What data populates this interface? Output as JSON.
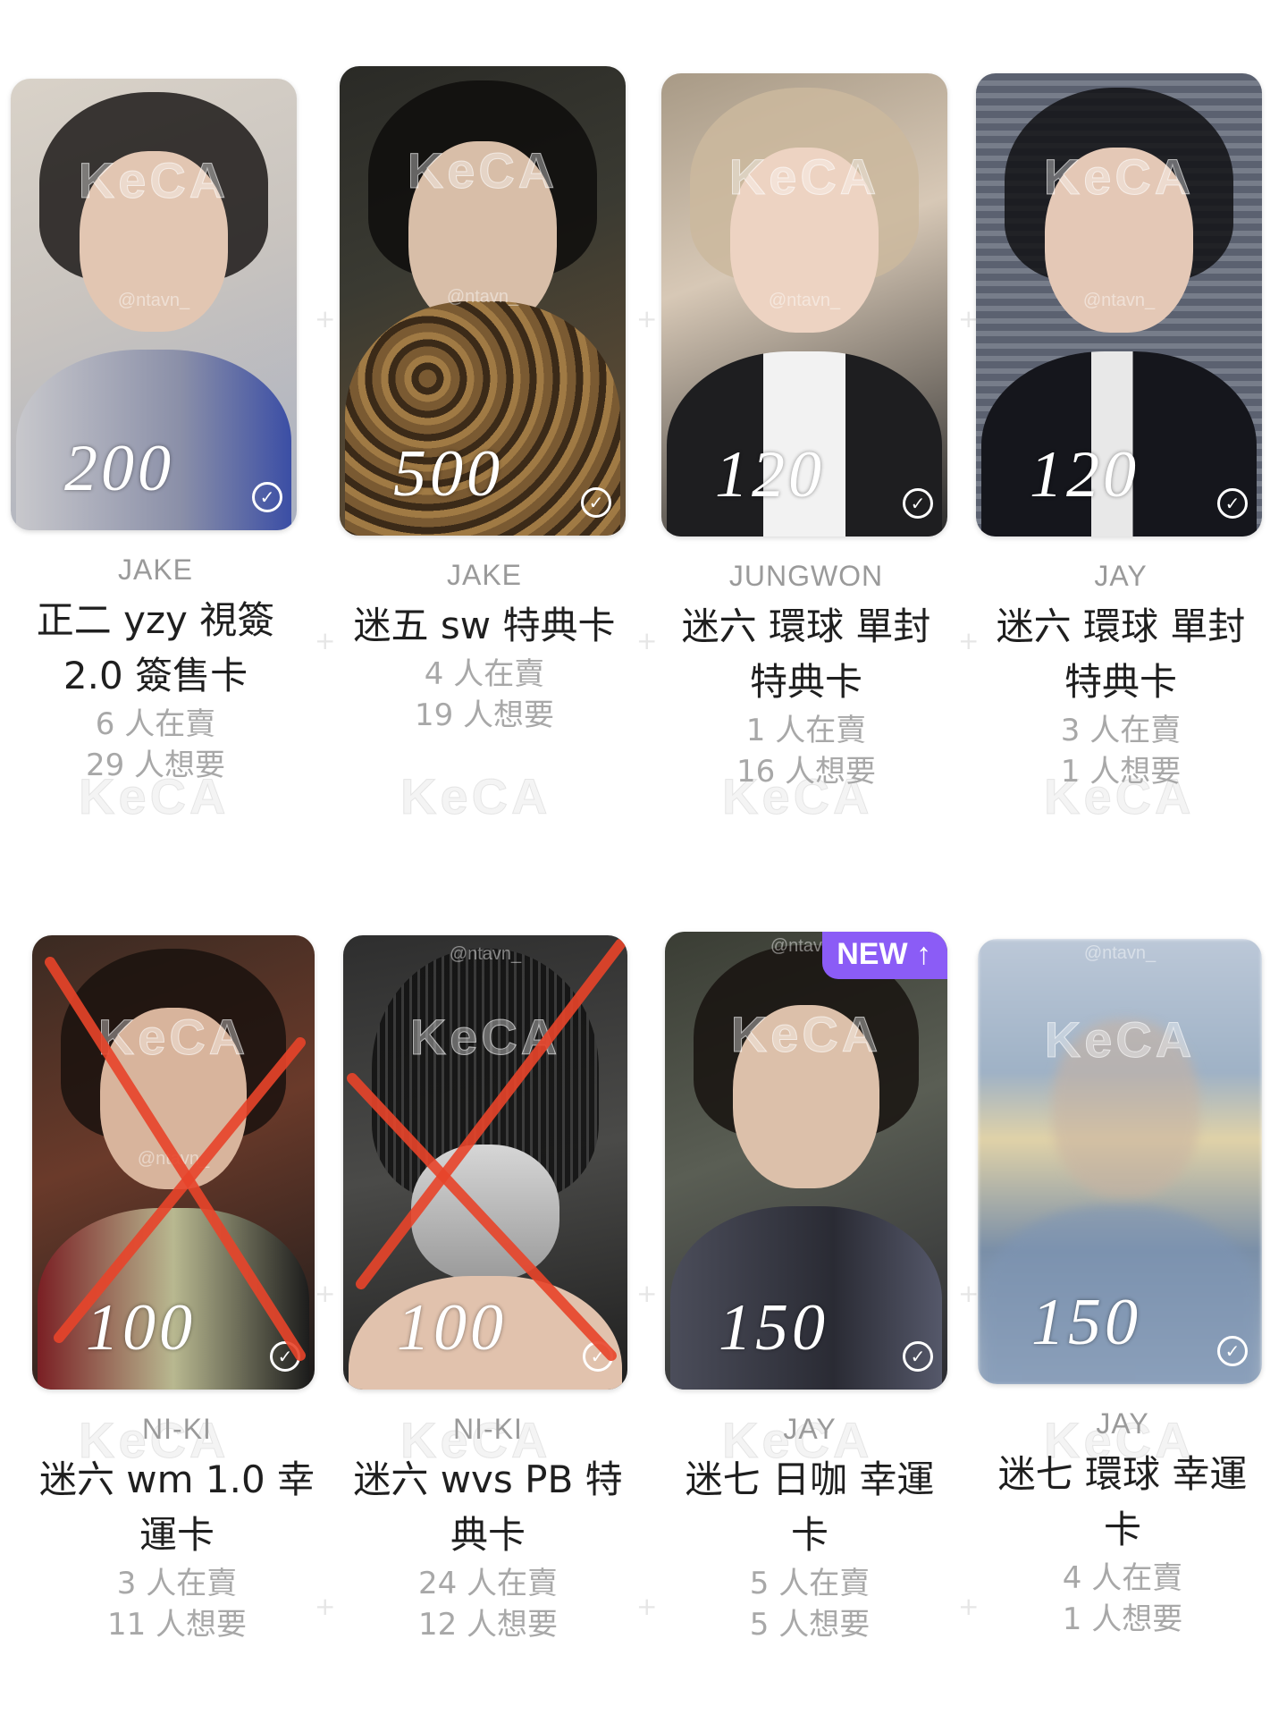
{
  "watermark": "KeCA",
  "handle": "@ntavn_",
  "stat_sell_suffix": "人在賣",
  "stat_want_suffix": "人想要",
  "badge_new": "NEW ↑",
  "colors": {
    "badge": "#8b5cf6",
    "cross": "#e8442a"
  },
  "cards": [
    {
      "member": "JAKE",
      "title_lines": [
        "正二 yzy 視簽",
        "2.0 簽售卡"
      ],
      "price": "200",
      "sellers": "6",
      "wanters": "29",
      "sold_out": false,
      "is_new": false
    },
    {
      "member": "JAKE",
      "title_lines": [
        "迷五 sw 特典卡"
      ],
      "price": "500",
      "sellers": "4",
      "wanters": "19",
      "sold_out": false,
      "is_new": false
    },
    {
      "member": "JUNGWON",
      "title_lines": [
        "迷六 環球 單封",
        "特典卡"
      ],
      "price": "120",
      "sellers": "1",
      "wanters": "16",
      "sold_out": false,
      "is_new": false
    },
    {
      "member": "JAY",
      "title_lines": [
        "迷六 環球 單封",
        "特典卡"
      ],
      "price": "120",
      "sellers": "3",
      "wanters": "1",
      "sold_out": false,
      "is_new": false
    },
    {
      "member": "NI-KI",
      "title_lines": [
        "迷六 wm 1.0 幸",
        "運卡"
      ],
      "price": "100",
      "sellers": "3",
      "wanters": "11",
      "sold_out": true,
      "is_new": false
    },
    {
      "member": "NI-KI",
      "title_lines": [
        "迷六 wvs PB 特",
        "典卡"
      ],
      "price": "100",
      "sellers": "24",
      "wanters": "12",
      "sold_out": true,
      "is_new": false
    },
    {
      "member": "JAY",
      "title_lines": [
        "迷七 日咖 幸運",
        "卡"
      ],
      "price": "150",
      "sellers": "5",
      "wanters": "5",
      "sold_out": false,
      "is_new": true
    },
    {
      "member": "JAY",
      "title_lines": [
        "迷七 環球 幸運",
        "卡"
      ],
      "price": "150",
      "sellers": "4",
      "wanters": "1",
      "sold_out": false,
      "is_new": false
    }
  ]
}
